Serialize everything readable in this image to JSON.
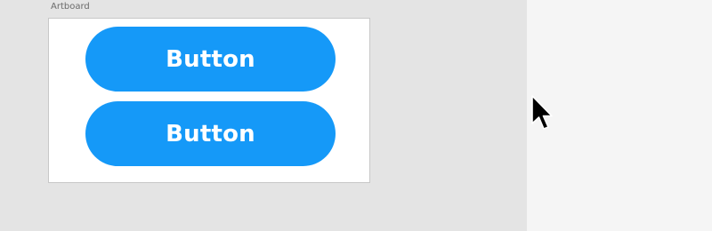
{
  "canvas": {
    "artboard_label": "Artboard",
    "background_color": "#e4e4e4",
    "artboard_color": "#ffffff"
  },
  "artboard": {
    "buttons": [
      {
        "label": "Button",
        "color": "#1599f8"
      },
      {
        "label": "Button",
        "color": "#1599f8"
      }
    ]
  },
  "cursor": {
    "icon": "arrow-cursor-icon"
  }
}
